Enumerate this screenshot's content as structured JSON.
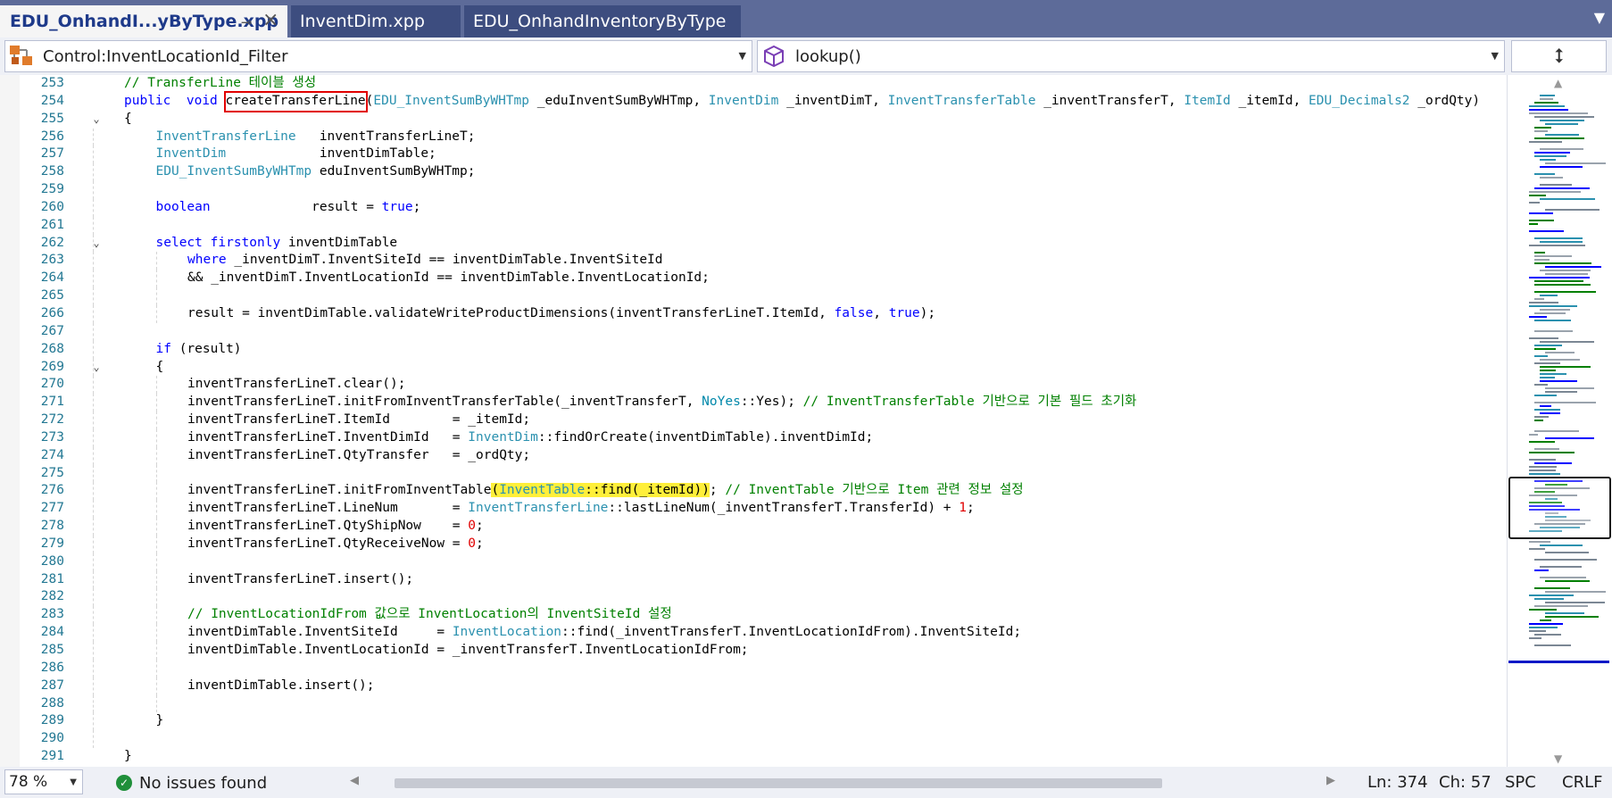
{
  "tabs": [
    {
      "label": "EDU_OnhandI...yByType.xpp",
      "active": true
    },
    {
      "label": "InventDim.xpp",
      "active": false
    },
    {
      "label": "EDU_OnhandInventoryByType",
      "active": false
    }
  ],
  "navigation": {
    "left_dropdown": "Control:InventLocationId_Filter",
    "right_dropdown": "lookup()"
  },
  "code_lines": [
    {
      "n": "253",
      "indent": 0,
      "fold": "",
      "tokens": [
        [
          "cm",
          "// TransferLine 테이블 생성"
        ]
      ]
    },
    {
      "n": "254",
      "indent": 0,
      "fold": "",
      "tokens": [
        [
          "kw",
          "public"
        ],
        [
          "",
          "  "
        ],
        [
          "kw",
          "void"
        ],
        [
          "",
          " "
        ],
        [
          "box",
          "createTransferLine"
        ],
        [
          "",
          "("
        ],
        [
          "ty",
          "EDU_InventSumByWHTmp"
        ],
        [
          "",
          " _eduInventSumByWHTmp, "
        ],
        [
          "ty",
          "InventDim"
        ],
        [
          "",
          " _inventDimT, "
        ],
        [
          "ty",
          "InventTransferTable"
        ],
        [
          "",
          " _inventTransferT, "
        ],
        [
          "ty",
          "ItemId"
        ],
        [
          "",
          " _itemId, "
        ],
        [
          "ty",
          "EDU_Decimals2"
        ],
        [
          "",
          " _ordQty)"
        ]
      ]
    },
    {
      "n": "255",
      "indent": 0,
      "fold": "v",
      "tokens": [
        [
          "",
          "{"
        ]
      ]
    },
    {
      "n": "256",
      "indent": 1,
      "fold": "",
      "tokens": [
        [
          "ty",
          "InventTransferLine"
        ],
        [
          "",
          "   inventTransferLineT;"
        ]
      ]
    },
    {
      "n": "257",
      "indent": 1,
      "fold": "",
      "tokens": [
        [
          "ty",
          "InventDim"
        ],
        [
          "",
          "            inventDimTable;"
        ]
      ]
    },
    {
      "n": "258",
      "indent": 1,
      "fold": "",
      "tokens": [
        [
          "ty",
          "EDU_InventSumByWHTmp"
        ],
        [
          "",
          " eduInventSumByWHTmp;"
        ]
      ]
    },
    {
      "n": "259",
      "indent": 1,
      "fold": "",
      "tokens": []
    },
    {
      "n": "260",
      "indent": 1,
      "fold": "",
      "tokens": [
        [
          "kw",
          "boolean"
        ],
        [
          "",
          "             result = "
        ],
        [
          "kw",
          "true"
        ],
        [
          "",
          ";"
        ]
      ]
    },
    {
      "n": "261",
      "indent": 1,
      "fold": "",
      "tokens": []
    },
    {
      "n": "262",
      "indent": 1,
      "fold": "v",
      "tokens": [
        [
          "kw",
          "select"
        ],
        [
          "",
          " "
        ],
        [
          "kw",
          "firstonly"
        ],
        [
          "",
          " inventDimTable"
        ]
      ]
    },
    {
      "n": "263",
      "indent": 2,
      "fold": "",
      "tokens": [
        [
          "kw",
          "where"
        ],
        [
          "",
          " _inventDimT.InventSiteId == inventDimTable.InventSiteId"
        ]
      ]
    },
    {
      "n": "264",
      "indent": 2,
      "fold": "",
      "tokens": [
        [
          "",
          "&& _inventDimT.InventLocationId == inventDimTable.InventLocationId;"
        ]
      ]
    },
    {
      "n": "265",
      "indent": 2,
      "fold": "",
      "tokens": []
    },
    {
      "n": "266",
      "indent": 2,
      "fold": "",
      "tokens": [
        [
          "",
          "result = inventDimTable.validateWriteProductDimensions(inventTransferLineT.ItemId, "
        ],
        [
          "kw",
          "false"
        ],
        [
          "",
          ", "
        ],
        [
          "kw",
          "true"
        ],
        [
          "",
          ");"
        ]
      ]
    },
    {
      "n": "267",
      "indent": 1,
      "fold": "",
      "tokens": []
    },
    {
      "n": "268",
      "indent": 1,
      "fold": "",
      "tokens": [
        [
          "kw",
          "if"
        ],
        [
          "",
          " (result)"
        ]
      ]
    },
    {
      "n": "269",
      "indent": 1,
      "fold": "v",
      "tokens": [
        [
          "",
          "{"
        ]
      ]
    },
    {
      "n": "270",
      "indent": 2,
      "fold": "",
      "tokens": [
        [
          "",
          "inventTransferLineT.clear();"
        ]
      ]
    },
    {
      "n": "271",
      "indent": 2,
      "fold": "",
      "tokens": [
        [
          "",
          "inventTransferLineT.initFromInventTransferTable(_inventTransferT, "
        ],
        [
          "en",
          "NoYes"
        ],
        [
          "",
          "::Yes); "
        ],
        [
          "cm",
          "// InventTransferTable 기반으로 기본 필드 초기화"
        ]
      ]
    },
    {
      "n": "272",
      "indent": 2,
      "fold": "",
      "tokens": [
        [
          "",
          "inventTransferLineT.ItemId        = _itemId;"
        ]
      ]
    },
    {
      "n": "273",
      "indent": 2,
      "fold": "",
      "tokens": [
        [
          "",
          "inventTransferLineT.InventDimId   = "
        ],
        [
          "ty",
          "InventDim"
        ],
        [
          "",
          "::findOrCreate(inventDimTable).inventDimId;"
        ]
      ]
    },
    {
      "n": "274",
      "indent": 2,
      "fold": "",
      "tokens": [
        [
          "",
          "inventTransferLineT.QtyTransfer   = _ordQty;"
        ]
      ]
    },
    {
      "n": "275",
      "indent": 2,
      "fold": "",
      "tokens": []
    },
    {
      "n": "276",
      "indent": 2,
      "fold": "",
      "tokens": [
        [
          "",
          "inventTransferLineT.initFromInventTable"
        ],
        [
          "hl",
          "("
        ],
        [
          "hlty",
          "InventTable"
        ],
        [
          "hl",
          "::find(_itemId)"
        ],
        [
          "hl",
          ")"
        ],
        [
          "",
          "; "
        ],
        [
          "cm",
          "// InventTable 기반으로 Item 관련 정보 설정"
        ]
      ]
    },
    {
      "n": "277",
      "indent": 2,
      "fold": "",
      "tokens": [
        [
          "",
          "inventTransferLineT.LineNum       = "
        ],
        [
          "ty",
          "InventTransferLine"
        ],
        [
          "",
          "::lastLineNum(_inventTransferT.TransferId) + "
        ],
        [
          "num",
          "1"
        ],
        [
          "",
          ";"
        ]
      ]
    },
    {
      "n": "278",
      "indent": 2,
      "fold": "",
      "tokens": [
        [
          "",
          "inventTransferLineT.QtyShipNow    = "
        ],
        [
          "num",
          "0"
        ],
        [
          "",
          ";"
        ]
      ]
    },
    {
      "n": "279",
      "indent": 2,
      "fold": "",
      "tokens": [
        [
          "",
          "inventTransferLineT.QtyReceiveNow = "
        ],
        [
          "num",
          "0"
        ],
        [
          "",
          ";"
        ]
      ]
    },
    {
      "n": "280",
      "indent": 2,
      "fold": "",
      "tokens": []
    },
    {
      "n": "281",
      "indent": 2,
      "fold": "",
      "tokens": [
        [
          "",
          "inventTransferLineT.insert();"
        ]
      ]
    },
    {
      "n": "282",
      "indent": 2,
      "fold": "",
      "tokens": []
    },
    {
      "n": "283",
      "indent": 2,
      "fold": "",
      "tokens": [
        [
          "cm",
          "// InventLocationIdFrom 값으로 InventLocation의 InventSiteId 설정"
        ]
      ]
    },
    {
      "n": "284",
      "indent": 2,
      "fold": "",
      "tokens": [
        [
          "",
          "inventDimTable.InventSiteId     = "
        ],
        [
          "ty",
          "InventLocation"
        ],
        [
          "",
          "::find(_inventTransferT.InventLocationIdFrom).InventSiteId;"
        ]
      ]
    },
    {
      "n": "285",
      "indent": 2,
      "fold": "",
      "tokens": [
        [
          "",
          "inventDimTable.InventLocationId = _inventTransferT.InventLocationIdFrom;"
        ]
      ]
    },
    {
      "n": "286",
      "indent": 2,
      "fold": "",
      "tokens": []
    },
    {
      "n": "287",
      "indent": 2,
      "fold": "",
      "tokens": [
        [
          "",
          "inventDimTable.insert();"
        ]
      ]
    },
    {
      "n": "288",
      "indent": 2,
      "fold": "",
      "tokens": []
    },
    {
      "n": "289",
      "indent": 1,
      "fold": "",
      "tokens": [
        [
          "",
          "}"
        ]
      ]
    },
    {
      "n": "290",
      "indent": 1,
      "fold": "",
      "tokens": []
    },
    {
      "n": "291",
      "indent": 0,
      "fold": "",
      "tokens": [
        [
          "",
          "}"
        ]
      ]
    }
  ],
  "statusbar": {
    "zoom": "78 %",
    "issues": "No issues found",
    "line": "Ln: 374",
    "char": "Ch: 57",
    "spacing": "SPC",
    "line_ending": "CRLF"
  },
  "colors": {
    "keyword": "#0000ff",
    "type": "#2b91af",
    "comment": "#008000",
    "number": "#e00000",
    "line_number": "#237893",
    "highlight": "#ffef3a",
    "box_outline": "#e10000"
  },
  "icons": {
    "nav_left": "class-hierarchy-icon",
    "nav_right": "method-cube-icon",
    "split": "split-editor-icon",
    "issues": "check-circle-icon"
  }
}
